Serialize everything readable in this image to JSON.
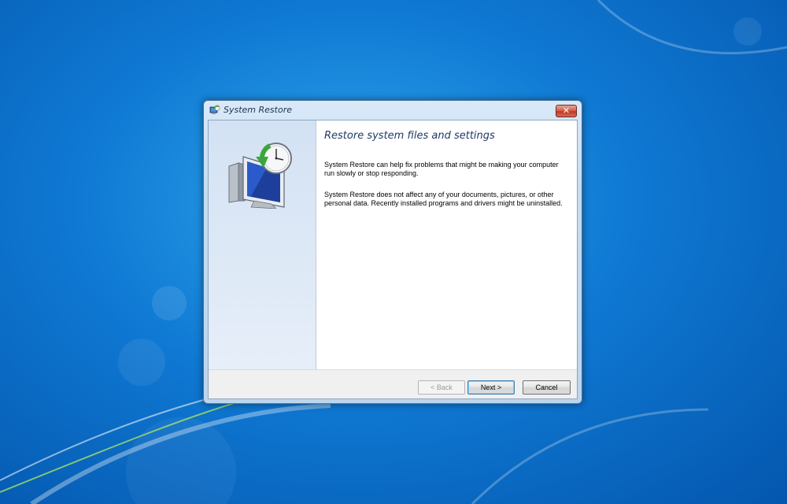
{
  "window": {
    "title": "System Restore",
    "close_label": "✕"
  },
  "content": {
    "heading": "Restore system files and settings",
    "paragraph1": "System Restore can help fix problems that might be making your computer run slowly or stop responding.",
    "paragraph2": "System Restore does not affect any of your documents, pictures, or other personal data. Recently installed programs and drivers might be uninstalled."
  },
  "buttons": {
    "back": "< Back",
    "next": "Next >",
    "cancel": "Cancel"
  },
  "icons": {
    "title": "system-restore-icon",
    "hero": "computer-restore-clock-icon"
  },
  "colors": {
    "desktop": "#0f79d3",
    "heading": "#1e3a66",
    "close_button": "#c0392b"
  }
}
